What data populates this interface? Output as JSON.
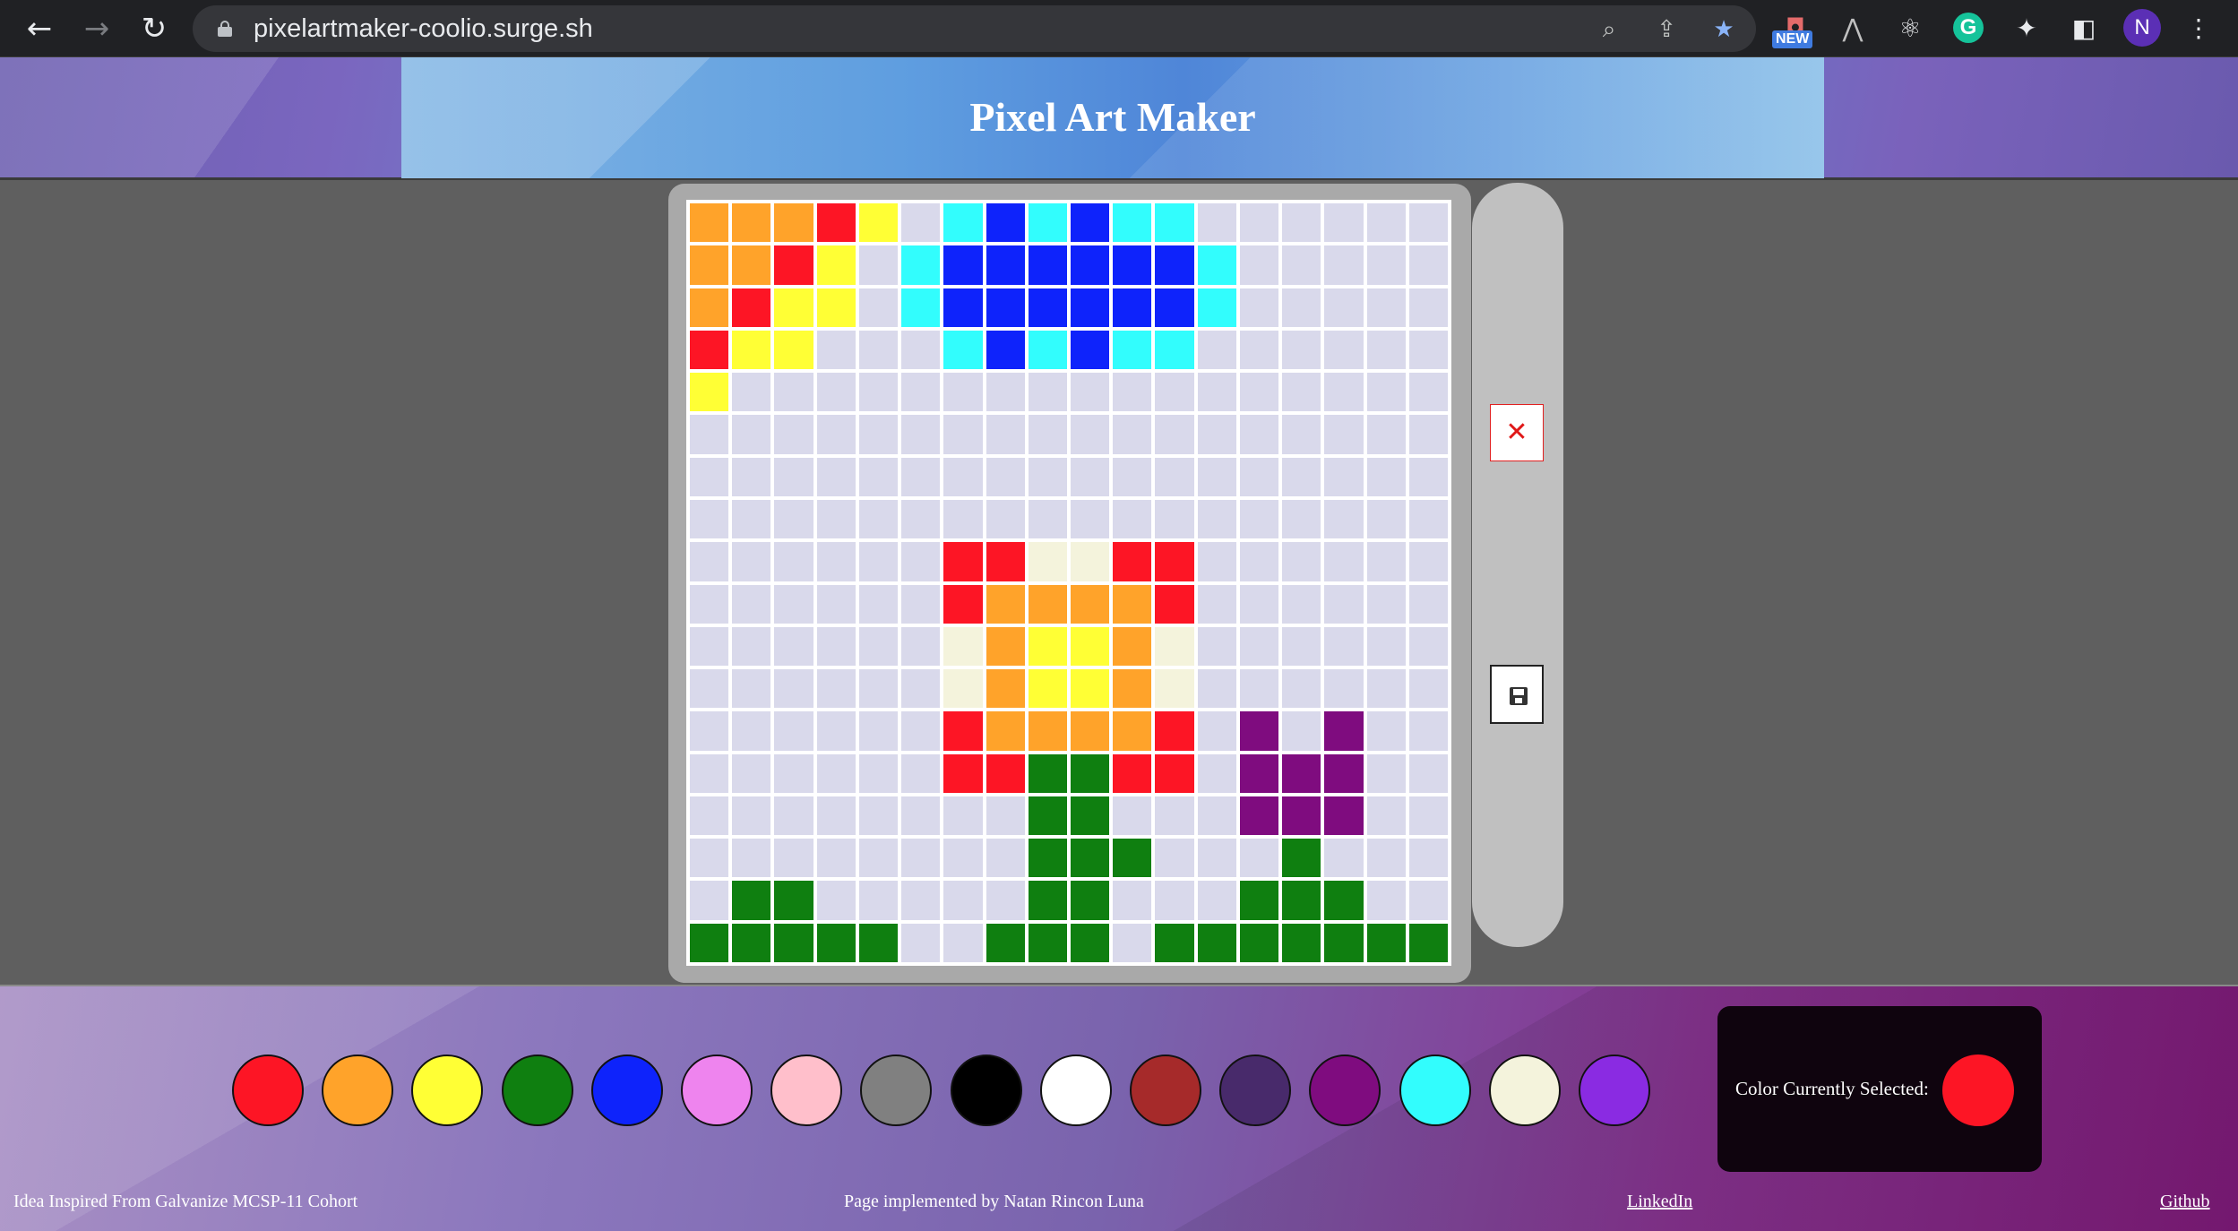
{
  "browser": {
    "url": "pixelartmaker-coolio.surge.sh",
    "new_badge": "NEW",
    "profile_initial": "N",
    "grammarly_letter": "G"
  },
  "header": {
    "title": "Pixel Art Maker"
  },
  "grid": {
    "rows": 18,
    "cols": 18,
    "empty_color": "#d9d9eb",
    "color_codes": {
      ".": "#d9d9eb",
      "O": "#ffa32a",
      "R": "#fd1525",
      "Y": "#ffff35",
      "C": "#32fdfd",
      "B": "#0e23fb",
      "G": "#0f7f10",
      "P": "#7f0c7f",
      "W": "#f4f3dc"
    },
    "pixels": [
      "OOORY.CBCBCC......",
      "OORY.CBBBBBBC.....",
      "ORYY.CBBBBBBC.....",
      "RYY...CBCBCC......",
      "Y.................",
      "..................",
      "..................",
      "..................",
      "......RRWWRR......",
      "......ROOOOR......",
      "......WOYYOW......",
      "......WOYYOW......",
      "......ROOOOR.P.P..",
      "......RRGGRR.PPP..",
      "........GG...PPP..",
      "........GGG...G...",
      ".GG.....GG...GGG..",
      "GGGGG..GGG.GGGGGGG"
    ]
  },
  "tools": {
    "clear_glyph": "✕",
    "clear_icon": "close-icon",
    "save_icon": "floppy-disk-icon"
  },
  "palette": {
    "colors": [
      "#fd1525",
      "#ffa32a",
      "#ffff35",
      "#0f7f10",
      "#0e23fb",
      "#ee84ee",
      "#ffbfcb",
      "#808080",
      "#000000",
      "#ffffff",
      "#a62a2a",
      "#482a6b",
      "#7f0c7f",
      "#32fdfd",
      "#f4f3dc",
      "#8a2be2"
    ]
  },
  "selected": {
    "label": "Color Currently Selected:",
    "color": "#fd1525"
  },
  "footer": {
    "inspiration": "Idea Inspired From Galvanize MCSP-11 Cohort",
    "credit": "Page implemented by Natan Rincon Luna",
    "linkedin": "LinkedIn",
    "github": "Github"
  }
}
